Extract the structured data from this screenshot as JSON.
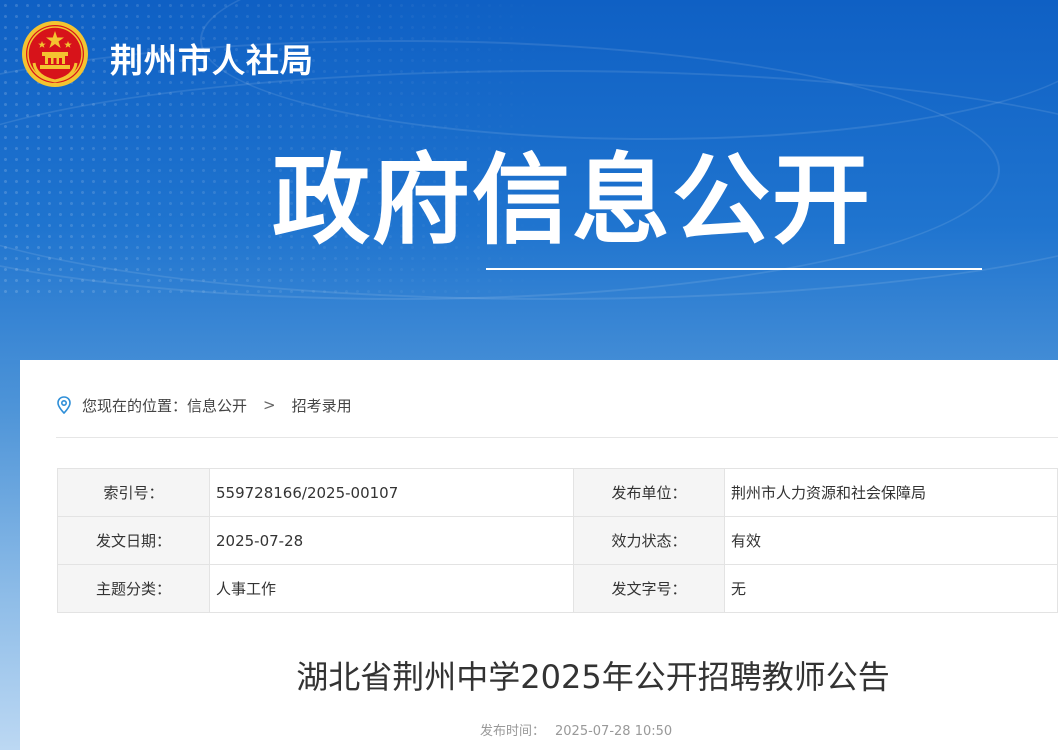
{
  "header": {
    "site_name": "荆州市人社局",
    "hero_title": "政府信息公开",
    "emblem": "national-emblem-icon"
  },
  "breadcrumb": {
    "prefix": "您现在的位置：",
    "items": [
      "信息公开",
      "招考录用"
    ],
    "separator": ">",
    "icon": "location-pin-icon"
  },
  "meta": {
    "rows": [
      {
        "k1": "索引号：",
        "v1": "559728166/2025-00107",
        "k2": "发布单位：",
        "v2": "荆州市人力资源和社会保障局"
      },
      {
        "k1": "发文日期：",
        "v1": "2025-07-28",
        "k2": "效力状态：",
        "v2": "有效"
      },
      {
        "k1": "主题分类：",
        "v1": "人事工作",
        "k2": "发文字号：",
        "v2": "无"
      }
    ]
  },
  "article": {
    "title": "湖北省荆州中学2025年公开招聘教师公告",
    "pub_label": "发布时间：",
    "pub_time": "2025-07-28 10:50"
  },
  "colors": {
    "banner_top": "#0f60c4",
    "banner_bottom": "#bcd8f3",
    "emblem_red": "#d7131a",
    "emblem_gold": "#f4c430",
    "icon_blue": "#2f8fd8"
  }
}
